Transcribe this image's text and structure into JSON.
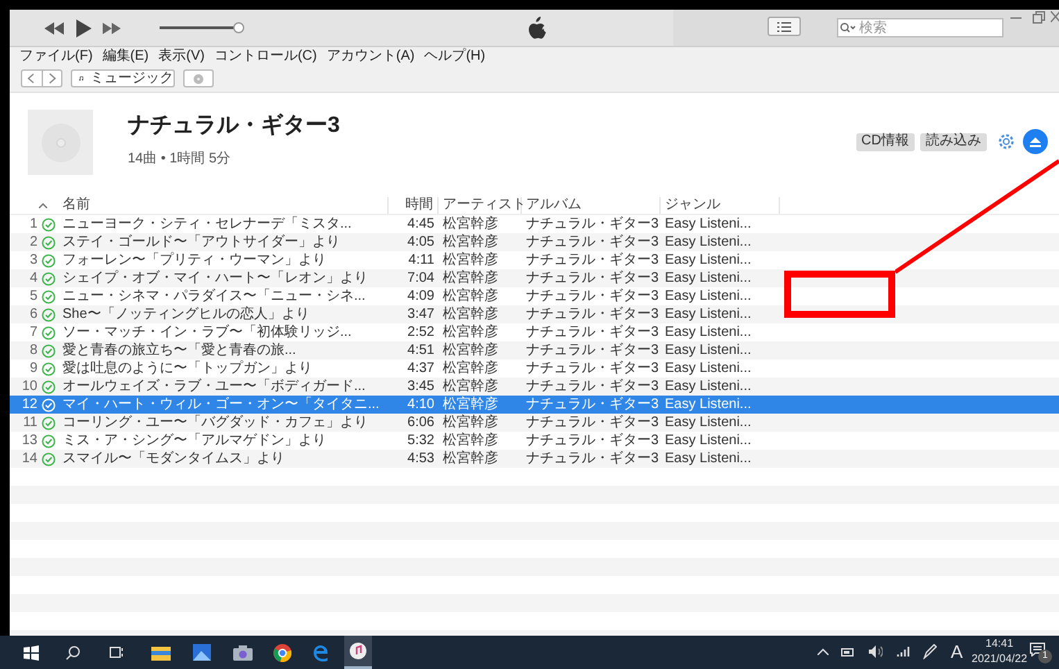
{
  "player": {
    "volume": {
      "level": 0.95
    },
    "search": {
      "placeholder": "検索"
    }
  },
  "menu": [
    "ファイル(F)",
    "編集(E)",
    "表示(V)",
    "コントロール(C)",
    "アカウント(A)",
    "ヘルプ(H)"
  ],
  "nav": {
    "location": "ミュージック"
  },
  "album": {
    "title": "ナチュラル・ギター3",
    "subtitle": "14曲 • 1時間 5分",
    "buttons": [
      "CD情報",
      "読み込み"
    ]
  },
  "table": {
    "columns": [
      "名前",
      "時間",
      "アーティスト",
      "アルバム",
      "ジャンル"
    ],
    "rows": [
      {
        "number": "1",
        "name": "ニューヨーク・シティ・セレナーデ「ミスタ...",
        "time": "4:45",
        "artist": "松宮幹彦",
        "album": "ナチュラル・ギター3",
        "genre": "Easy Listeni...",
        "checked": true,
        "selected": false
      },
      {
        "number": "2",
        "name": "ステイ・ゴールド〜「アウトサイダー」より",
        "time": "4:05",
        "artist": "松宮幹彦",
        "album": "ナチュラル・ギター3",
        "genre": "Easy Listeni...",
        "checked": true,
        "selected": false
      },
      {
        "number": "3",
        "name": "フォーレン〜「プリティ・ウーマン」より",
        "time": "4:11",
        "artist": "松宮幹彦",
        "album": "ナチュラル・ギター3",
        "genre": "Easy Listeni...",
        "checked": true,
        "selected": false
      },
      {
        "number": "4",
        "name": "シェイプ・オブ・マイ・ハート〜「レオン」より",
        "time": "7:04",
        "artist": "松宮幹彦",
        "album": "ナチュラル・ギター3",
        "genre": "Easy Listeni...",
        "checked": true,
        "selected": false
      },
      {
        "number": "5",
        "name": "ニュー・シネマ・パラダイス〜「ニュー・シネ...",
        "time": "4:09",
        "artist": "松宮幹彦",
        "album": "ナチュラル・ギター3",
        "genre": "Easy Listeni...",
        "checked": true,
        "selected": false
      },
      {
        "number": "6",
        "name": "She〜「ノッティングヒルの恋人」より",
        "time": "3:47",
        "artist": "松宮幹彦",
        "album": "ナチュラル・ギター3",
        "genre": "Easy Listeni...",
        "checked": true,
        "selected": false
      },
      {
        "number": "7",
        "name": "ソー・マッチ・イン・ラブ〜「初体験リッジ...",
        "time": "2:52",
        "artist": "松宮幹彦",
        "album": "ナチュラル・ギター3",
        "genre": "Easy Listeni...",
        "checked": true,
        "selected": false
      },
      {
        "number": "8",
        "name": "愛と青春の旅立ち〜「愛と青春の旅...",
        "time": "4:51",
        "artist": "松宮幹彦",
        "album": "ナチュラル・ギター3",
        "genre": "Easy Listeni...",
        "checked": true,
        "selected": false
      },
      {
        "number": "9",
        "name": "愛は吐息のように〜「トップガン」より",
        "time": "4:37",
        "artist": "松宮幹彦",
        "album": "ナチュラル・ギター3",
        "genre": "Easy Listeni...",
        "checked": true,
        "selected": false
      },
      {
        "number": "10",
        "name": "オールウェイズ・ラブ・ユー〜「ボディガード...",
        "time": "3:45",
        "artist": "松宮幹彦",
        "album": "ナチュラル・ギター3",
        "genre": "Easy Listeni...",
        "checked": true,
        "selected": false
      },
      {
        "number": "12",
        "name": "マイ・ハート・ウィル・ゴー・オン〜「タイタニ...",
        "time": "4:10",
        "artist": "松宮幹彦",
        "album": "ナチュラル・ギター3",
        "genre": "Easy Listeni...",
        "checked": true,
        "selected": true
      },
      {
        "number": "11",
        "name": "コーリング・ユー〜「バグダッド・カフェ」より",
        "time": "6:06",
        "artist": "松宮幹彦",
        "album": "ナチュラル・ギター3",
        "genre": "Easy Listeni...",
        "checked": true,
        "selected": false
      },
      {
        "number": "13",
        "name": "ミス・ア・シング〜「アルマゲドン」より",
        "time": "5:32",
        "artist": "松宮幹彦",
        "album": "ナチュラル・ギター3",
        "genre": "Easy Listeni...",
        "checked": true,
        "selected": false
      },
      {
        "number": "14",
        "name": "スマイル〜「モダンタイムス」より",
        "time": "4:53",
        "artist": "松宮幹彦",
        "album": "ナチュラル・ギター3",
        "genre": "Easy Listeni...",
        "checked": true,
        "selected": false
      }
    ]
  },
  "taskbar": {
    "tray_letter": "A",
    "time": "14:41",
    "date": "2021/04/22",
    "notification_count": "1"
  }
}
